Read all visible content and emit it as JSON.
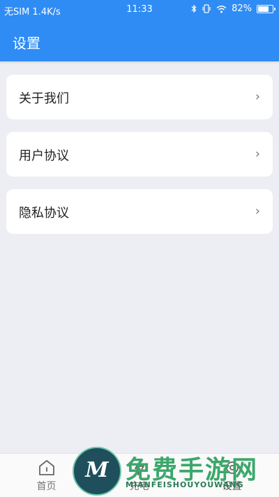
{
  "status_bar": {
    "carrier": "无SIM 1.4K/s",
    "time": "11:33",
    "battery": "82%",
    "battery_level": 0.82,
    "icons": [
      "bluetooth-icon",
      "vibrate-icon",
      "wifi-icon",
      "battery-icon"
    ]
  },
  "header": {
    "title": "设置"
  },
  "menu": {
    "items": [
      {
        "label": "关于我们",
        "chevron": "›"
      },
      {
        "label": "用户协议",
        "chevron": "›"
      },
      {
        "label": "隐私协议",
        "chevron": "›"
      }
    ]
  },
  "tabbar": {
    "tabs": [
      {
        "label": "首页",
        "icon": "home-icon"
      },
      {
        "label": "充电",
        "icon": "charge-icon"
      },
      {
        "label": "设置",
        "icon": "settings-icon"
      }
    ]
  },
  "watermark": {
    "text": "免费手游网",
    "subtitle": "MIANFEISHOUYOUWANG",
    "logo_letter": "M"
  },
  "colors": {
    "accent": "#2f8cf5",
    "background": "#eceef3",
    "card": "#ffffff"
  }
}
